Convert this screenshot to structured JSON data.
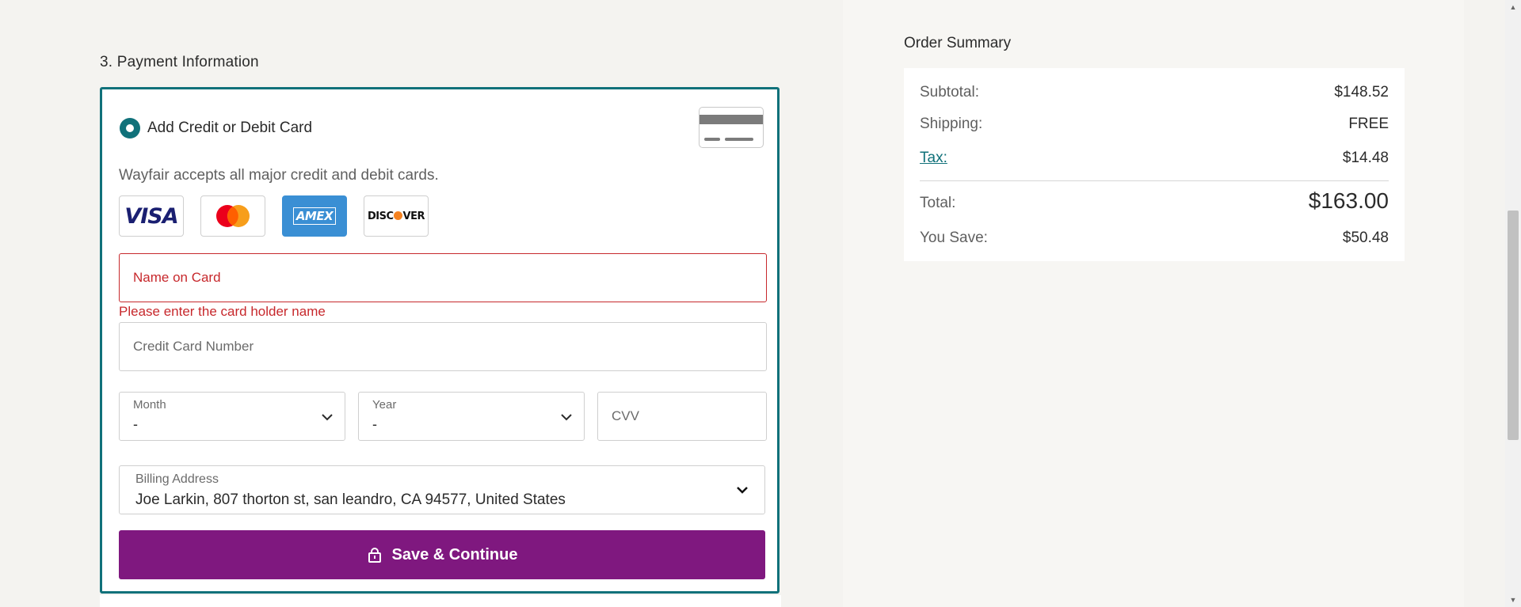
{
  "payment": {
    "section_title": "3. Payment Information",
    "option_label": "Add Credit or Debit Card",
    "accepts_text": "Wayfair accepts all major credit and debit cards.",
    "brands": [
      "VISA",
      "mastercard",
      "AMEX",
      "DISCOVER"
    ],
    "name_placeholder": "Name on Card",
    "name_error": "Please enter the card holder name",
    "card_number_placeholder": "Credit Card Number",
    "month": {
      "label": "Month",
      "value": "-"
    },
    "year": {
      "label": "Year",
      "value": "-"
    },
    "cvv_placeholder": "CVV",
    "billing": {
      "label": "Billing Address",
      "value": "Joe Larkin, 807 thorton st, san leandro, CA 94577, United States"
    },
    "save_label": "Save & Continue"
  },
  "summary": {
    "title": "Order Summary",
    "subtotal_label": "Subtotal:",
    "subtotal_value": "$148.52",
    "shipping_label": "Shipping:",
    "shipping_value": "FREE",
    "tax_label": "Tax:",
    "tax_value": "$14.48",
    "total_label": "Total:",
    "total_value": "$163.00",
    "save_label": "You Save:",
    "save_value": "$50.48"
  },
  "colors": {
    "accent_teal": "#10717a",
    "button_purple": "#7f187f",
    "error_red": "#c7282c"
  },
  "icons": [
    "radio-selected-icon",
    "credit-card-icon",
    "chevron-down-icon",
    "lock-icon"
  ]
}
